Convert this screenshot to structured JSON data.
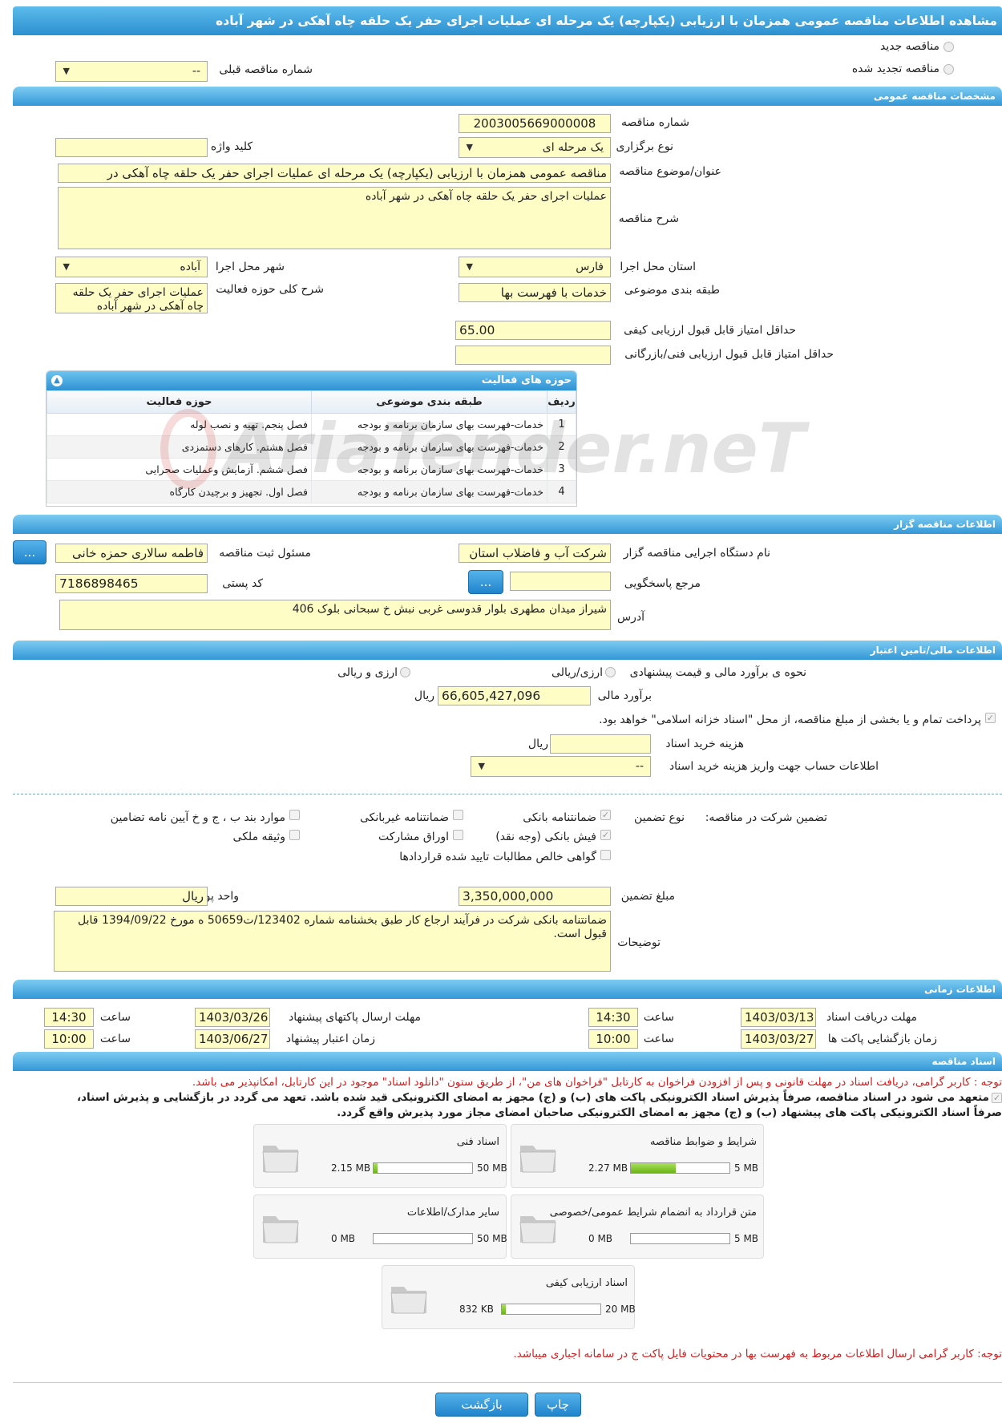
{
  "title": "مشاهده اطلاعات مناقصه عمومی همزمان با ارزیابی (یکپارچه) یک مرحله ای عملیات اجرای حفر یک حلقه چاه آهکی در شهر آباده",
  "tender_type": {
    "new": "مناقصه جدید",
    "renewed": "مناقصه تجدید شده",
    "prev_number_label": "شماره مناقصه قبلی",
    "prev_number_value": "--"
  },
  "general": {
    "section_title": "مشخصات مناقصه عمومی",
    "number_label": "شماره مناقصه",
    "number": "2003005669000008",
    "holding_type_label": "نوع برگزاری",
    "holding_type": "یک مرحله ای",
    "keyword_label": "کلید واژه",
    "keyword": "",
    "subject_label": "عنوان/موضوع مناقصه",
    "subject": "مناقصه عمومی همزمان با ارزیابی (یکپارچه) یک مرحله ای عملیات اجرای حفر یک حلقه چاه آهکی در",
    "description_label": "شرح مناقصه",
    "description": "عملیات اجرای حفر یک حلقه چاه آهکی در شهر آباده",
    "province_label": "استان محل اجرا",
    "province": "فارس",
    "city_label": "شهر محل اجرا",
    "city": "آباده",
    "category_label": "طبقه بندی موضوعی",
    "category": "خدمات با فهرست بها",
    "activity_desc_label": "شرح کلی حوزه فعالیت",
    "activity_desc": "عملیات اجرای حفر یک حلقه چاه آهکی در شهر آباده",
    "min_quality_label": "حداقل امتیاز قابل قبول ارزیابی کیفی",
    "min_quality": "65.00",
    "min_tech_label": "حداقل امتیاز قابل قبول ارزیابی فنی/بازرگانی",
    "min_tech": ""
  },
  "activities": {
    "title": "حوزه های فعالیت",
    "headers": [
      "ردیف",
      "طبقه بندی موضوعی",
      "حوزه فعالیت"
    ],
    "rows": [
      [
        "1",
        "خدمات-فهرست بهای سازمان برنامه و بودجه",
        "فصل پنجم. تهیه و نصب لوله"
      ],
      [
        "2",
        "خدمات-فهرست بهای سازمان برنامه و بودجه",
        "فصل هشتم. کارهای دستمزدی"
      ],
      [
        "3",
        "خدمات-فهرست بهای سازمان برنامه و بودجه",
        "فصل ششم. آزمایش وعملیات صحرایی"
      ],
      [
        "4",
        "خدمات-فهرست بهای سازمان برنامه و بودجه",
        "فصل اول. تجهیز و برچیدن کارگاه"
      ]
    ]
  },
  "organizer": {
    "section_title": "اطلاعات مناقصه گزار",
    "org_label": "نام دستگاه اجرایی مناقصه گزار",
    "org": "شرکت آب و فاضلاب استان",
    "registrar_label": "مسئول ثبت مناقصه",
    "registrar": "فاطمه سالاری حمزه خانی",
    "ref_label": "مرجع پاسخگویی",
    "ref": "",
    "postal_label": "کد پستی",
    "postal": "7186898465",
    "address_label": "آدرس",
    "address": "شیراز میدان مطهری بلوار قدوسی غربی نبش خ سبحانی بلوک 406",
    "dots": "..."
  },
  "finance": {
    "section_title": "اطلاعات مالی/تامین اعتبار",
    "method_label": "نحوه ی برآورد مالی و قیمت پیشنهادی",
    "opt1": "ارزی/ریالی",
    "opt2": "ارزی و ریالی",
    "estimate_label": "برآورد مالی",
    "estimate": "66,605,427,096",
    "rial": "ریال",
    "treasury_text": "پرداخت تمام و یا بخشی از مبلغ مناقصه، از محل \"اسناد خزانه اسلامی\" خواهد بود.",
    "doc_cost_label": "هزینه خرید اسناد",
    "doc_cost": "",
    "account_label": "اطلاعات حساب جهت واریز هزینه خرید اسناد",
    "account": "--"
  },
  "guarantee": {
    "participation_label": "تضمین شرکت در مناقصه:",
    "type_label": "نوع تضمین",
    "items": [
      "ضمانتنامه بانکی",
      "ضمانتنامه غیربانکی",
      "موارد بند ب ، ج و خ آیین نامه تضامین",
      "فیش بانکی (وجه نقد)",
      "اوراق مشارکت",
      "وثیقه ملکی",
      "گواهی خالص مطالبات تایید شده قراردادها"
    ],
    "amount_label": "مبلغ تضمین",
    "amount": "3,350,000,000",
    "unit_label": "واحد پول",
    "unit": "ریال",
    "notes_label": "توضیحات",
    "notes": "ضمانتنامه بانکی شرکت در فرآیند ارجاع کار طبق بخشنامه شماره 123402/ت50659 ه مورخ 1394/09/22 قابل قبول است."
  },
  "timing": {
    "section_title": "اطلاعات زمانی",
    "receive_label": "مهلت دریافت اسناد",
    "receive_date": "1403/03/13",
    "receive_time": "14:30",
    "send_label": "مهلت ارسال پاکتهای پیشنهاد",
    "send_date": "1403/03/26",
    "send_time": "14:30",
    "open_label": "زمان بازگشایی پاکت ها",
    "open_date": "1403/03/27",
    "open_time": "10:00",
    "validity_label": "زمان اعتبار پیشنهاد",
    "validity_date": "1403/06/27",
    "validity_time": "10:00",
    "time_label": "ساعت"
  },
  "documents": {
    "section_title": "اسناد مناقصه",
    "notice": "توجه : کاربر گرامی، دریافت اسناد در مهلت قانونی و پس از افزودن فراخوان به کارتابل \"فراخوان های من\"، از طریق ستون \"دانلود اسناد\" موجود در این کارتابل، امکانپذیر می باشد.",
    "commit1": "متعهد می شود در اسناد مناقصه، صرفاً پذیرش اسناد الکترونیکی پاکت های (ب) و (ج) مجهز به امضای الکترونیکی قید شده باشد. تعهد می گردد در بازگشایی و پذیرش اسناد،",
    "commit2": "صرفاً اسناد الکترونیکی پاکت های پیشنهاد (ب) و (ج) مجهز به امضای الکترونیکی صاحبان امضای مجاز مورد پذیرش واقع گردد.",
    "files": [
      {
        "name": "شرایط و ضوابط مناقصه",
        "used": "2.27 MB",
        "max": "5 MB",
        "frac": 0.454
      },
      {
        "name": "اسناد فنی",
        "used": "2.15 MB",
        "max": "50 MB",
        "frac": 0.043
      },
      {
        "name": "متن قرارداد به انضمام شرایط عمومی/خصوصی",
        "used": "0 MB",
        "max": "5 MB",
        "frac": 0
      },
      {
        "name": "سایر مدارک/اطلاعات",
        "used": "0 MB",
        "max": "50 MB",
        "frac": 0
      },
      {
        "name": "اسناد ارزیابی کیفی",
        "used": "832 KB",
        "max": "20 MB",
        "frac": 0.04
      }
    ],
    "footer_notice": "توجه: کاربر گرامی ارسال اطلاعات مربوط به فهرست بها در محتویات فایل پاکت ج در سامانه اجباری میباشد."
  },
  "buttons": {
    "back": "بازگشت",
    "print": "چاپ"
  },
  "watermark": "AriaTender.neT",
  "colors": {
    "header_blue": "#2c8fcf",
    "field_yellow": "#fefdc6",
    "notice_red": "#d02020",
    "progress_green": "#8bd33a"
  }
}
